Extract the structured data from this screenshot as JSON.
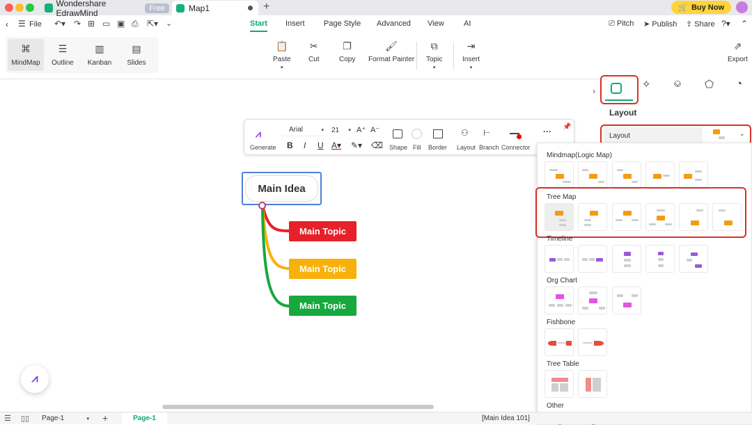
{
  "app": {
    "tabs": [
      {
        "label": "Wondershare EdrawMind",
        "badge": "Free"
      },
      {
        "label": "Map1"
      }
    ],
    "buy_now": "Buy Now"
  },
  "menubar": {
    "file": "File",
    "tabs": [
      "Start",
      "Insert",
      "Page Style",
      "Advanced",
      "View",
      "AI"
    ],
    "active_tab": "Start",
    "right": [
      "Pitch",
      "Publish",
      "Share"
    ]
  },
  "ribbon": {
    "views": [
      "MindMap",
      "Outline",
      "Kanban",
      "Slides"
    ],
    "tools": [
      "Paste",
      "Cut",
      "Copy",
      "Format Painter",
      "Topic",
      "Insert"
    ],
    "export": "Export"
  },
  "floatbar": {
    "generate": "Generate",
    "font": "Arial",
    "size": "21",
    "labels": [
      "Shape",
      "Fill",
      "Border",
      "Layout",
      "Branch",
      "Connector"
    ]
  },
  "mindmap": {
    "main_idea": "Main Idea",
    "topics": [
      {
        "label": "Main Topic",
        "color": "#e8202a"
      },
      {
        "label": "Main Topic",
        "color": "#f7b10a"
      },
      {
        "label": "Main Topic",
        "color": "#17a83e"
      }
    ]
  },
  "panel": {
    "title": "Layout",
    "field_label": "Layout",
    "sections": [
      "Mindmap(Logic Map)",
      "Tree Map",
      "Timeline",
      "Org Chart",
      "Fishbone",
      "Tree Table",
      "Other"
    ]
  },
  "status": {
    "page_selector": "Page-1",
    "page_tab": "Page-1",
    "selection": "[Main Idea 101]"
  }
}
